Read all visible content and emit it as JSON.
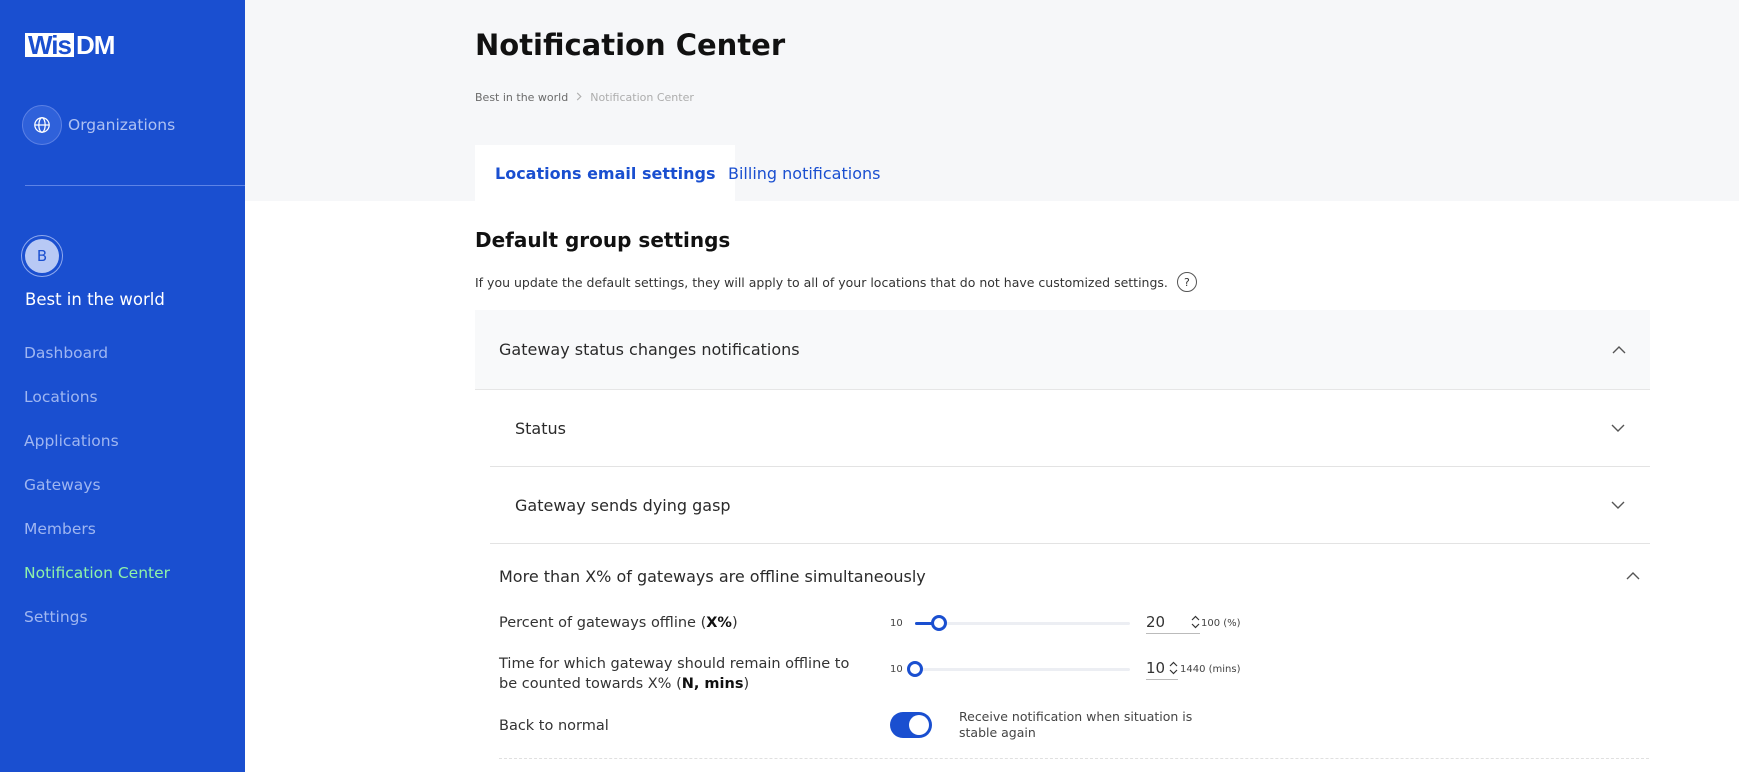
{
  "brand": {
    "logo_box": "Wis",
    "logo_rest": "DM",
    "accent": "#1a4fd0",
    "active_nav_color": "#8ff2a8"
  },
  "sidebar": {
    "organizations_label": "Organizations",
    "organizations_icon": "globe-icon",
    "account_initial": "B",
    "account_name": "Best in the world",
    "nav": [
      {
        "label": "Dashboard"
      },
      {
        "label": "Locations"
      },
      {
        "label": "Applications"
      },
      {
        "label": "Gateways"
      },
      {
        "label": "Members"
      },
      {
        "label": "Notification Center",
        "active": true
      },
      {
        "label": "Settings"
      }
    ]
  },
  "header": {
    "title": "Notification Center",
    "breadcrumb": [
      "Best in the world",
      "Notification Center"
    ],
    "tabs": [
      {
        "label": "Locations email settings",
        "active": true
      },
      {
        "label": "Billing notifications",
        "active": false
      }
    ]
  },
  "main": {
    "section_title": "Default group settings",
    "section_desc": "If you update the default settings, they will apply to all of your locations that do not have customized settings.",
    "help_icon_text": "?",
    "panels": {
      "gateway_status": "Gateway status changes notifications",
      "status": "Status",
      "dying_gasp": "Gateway sends dying gasp",
      "offline": "More than X% of gateways are offline simultaneously"
    },
    "percent_row": {
      "label_prefix": "Percent of gateways offline (",
      "label_bold": "X%",
      "label_suffix": ")",
      "min": "10",
      "value": "20",
      "max": "100 (%)",
      "fraction": 0.111
    },
    "time_row": {
      "label_prefix": "Time for which gateway should remain offline to be counted towards X% (",
      "label_bold": "N, mins",
      "label_suffix": ")",
      "min": "10",
      "value": "10",
      "max": "1440 (mins)",
      "fraction": 0
    },
    "back_to_normal": {
      "label": "Back to normal",
      "enabled": true,
      "description": "Receive notification when situation is stable again"
    }
  }
}
